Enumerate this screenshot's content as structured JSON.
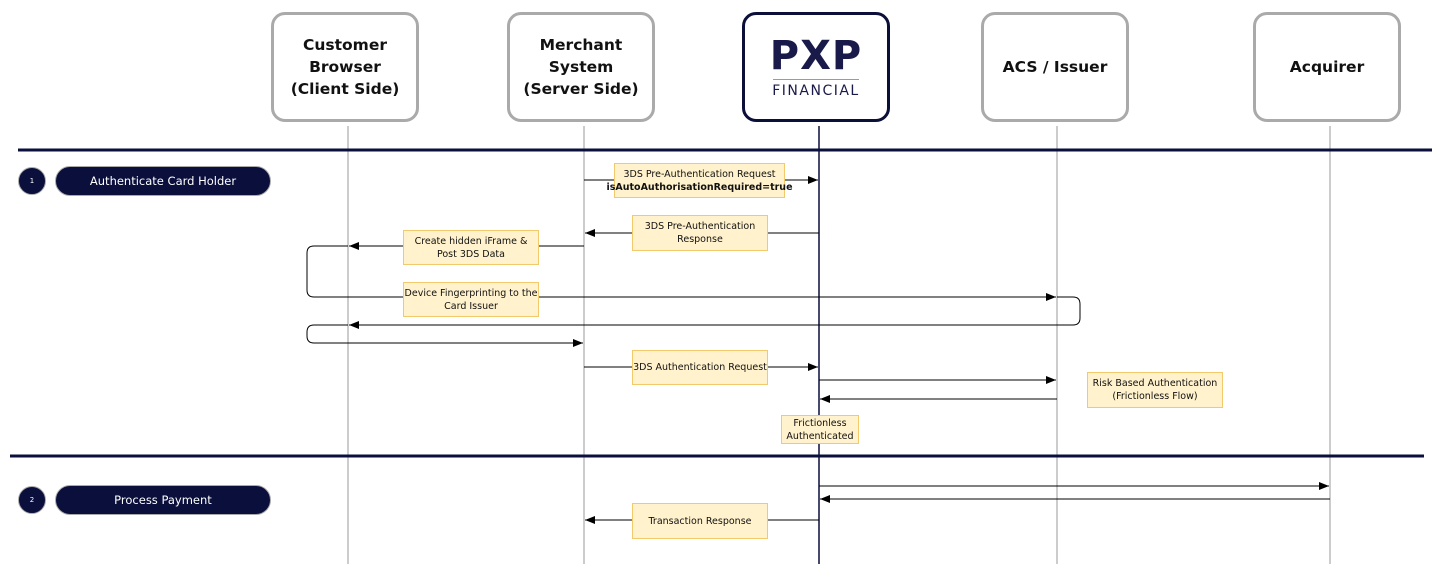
{
  "actors": [
    {
      "label": "Customer\nBrowser\n(Client Side)"
    },
    {
      "label": "Merchant\nSystem\n(Server Side)"
    },
    {
      "label": "PXP FINANCIAL",
      "logo_big": "PXP",
      "logo_small": "FINANCIAL"
    },
    {
      "label": "ACS / Issuer"
    },
    {
      "label": "Acquirer"
    }
  ],
  "sections": [
    {
      "number": "1",
      "title": "Authenticate Card Holder"
    },
    {
      "number": "2",
      "title": "Process Payment"
    }
  ],
  "messages": {
    "pre_auth_request": "3DS Pre-Authentication Request",
    "pre_auth_request_param": "isAutoAuthorisationRequired=true",
    "pre_auth_response": "3DS Pre-Authentication\nResponse",
    "hidden_iframe": "Create hidden iFrame &\nPost 3DS Data",
    "device_fingerprinting": "Device Fingerprinting to the\nCard Issuer",
    "auth_request": "3DS Authentication Request",
    "risk_based": "Risk Based Authentication\n(Frictionless Flow)",
    "frictionless": "Frictionless\nAuthenticated",
    "transaction_response": "Transaction Response"
  },
  "colors": {
    "navy": "#0a0f3c",
    "note_fill": "#fff2cc",
    "note_border": "#f2c96b",
    "lifeline": "#aaaaaa"
  }
}
